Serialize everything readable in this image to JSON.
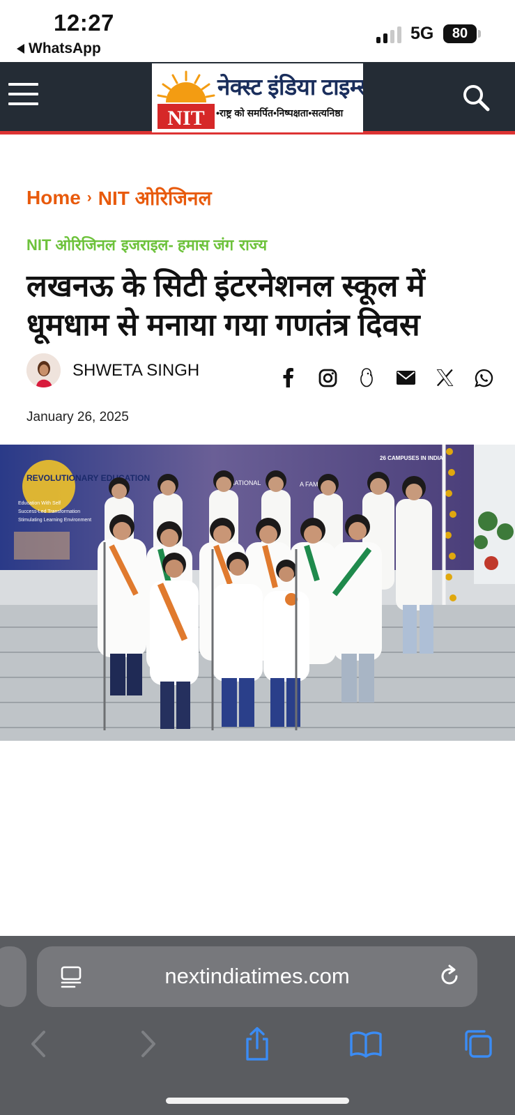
{
  "status_bar": {
    "time": "12:27",
    "back_app": "WhatsApp",
    "network": "5G",
    "battery": "80"
  },
  "header": {
    "menu_icon": "hamburger-menu-icon",
    "logo": {
      "mark": "NIT",
      "title": "नेक्स्ट इंडिया टाइम्स",
      "tagline": "•राष्ट्र को समर्पित•निष्पक्षता•सत्यनिष्ठा"
    },
    "search_icon": "search-icon",
    "colors": {
      "background": "#242c35",
      "accent_line": "#dd3333",
      "logo_orange": "#f39c12",
      "logo_red": "#d62828"
    }
  },
  "article": {
    "breadcrumb": {
      "home": "Home",
      "separator": "›",
      "section": "NIT ओरिजिनल"
    },
    "categories": [
      "NIT ओरिजिनल",
      "इजराइल- हमास जंग",
      "राज्य"
    ],
    "headline": "लखनऊ के सिटी इंटरनेशनल स्कूल में धूमधाम से मनाया गया गणतंत्र दिवस",
    "author": "SHWETA SINGH",
    "date": "January 26, 2025",
    "share_icons": [
      "facebook-icon",
      "instagram-icon",
      "koo-icon",
      "email-icon",
      "x-icon",
      "whatsapp-icon"
    ],
    "colors": {
      "breadcrumb": "#e85a0c",
      "categories": "#6dc23b"
    },
    "photo": {
      "alt": "children in white kurtas singing at a Republic Day celebration",
      "banner_text": {
        "left": "REVOLUTIONARY EDUCATION",
        "campuses": "26 CAMPUSES IN INDIA",
        "bullets": [
          "Education With Self",
          "Success-Led Transformation",
          "Stimulating Learning Environment"
        ],
        "center": "NATIONAL",
        "family": "A FAMILY"
      }
    }
  },
  "browser": {
    "url": "nextindiatimes.com",
    "reader_icon": "reader-mode-icon",
    "reload_icon": "reload-icon",
    "toolbar_icons": [
      "back-icon",
      "forward-icon",
      "share-icon",
      "bookmarks-icon",
      "tabs-icon"
    ]
  }
}
